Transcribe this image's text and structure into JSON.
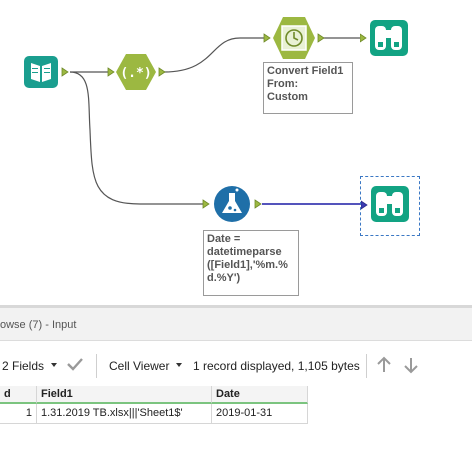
{
  "canvas": {
    "annotations": {
      "convert": "Convert Field1\nFrom:\nCustom",
      "formula": "Date =\ndatetimeparse\n([Field1],'%m.%\nd.%Y')"
    },
    "tools": {
      "input": {
        "icon": "book-icon",
        "color": "#1a9e8f"
      },
      "regex": {
        "icon": "regex-icon",
        "label": "(.*)",
        "color": "#9cb841"
      },
      "datetime": {
        "icon": "clock-icon",
        "color": "#9cb841"
      },
      "formula": {
        "icon": "flask-icon",
        "color": "#1f6fa8"
      },
      "browse_top": {
        "icon": "binoculars-icon",
        "color": "#12a383"
      },
      "browse_bottom": {
        "icon": "binoculars-icon",
        "color": "#12a383"
      }
    },
    "wire_color": "#555555",
    "selected_wire_color": "#3b3bb3"
  },
  "results": {
    "title": "owse (7) - Input",
    "toolbar": {
      "fields": "2 Fields",
      "viewer": "Cell Viewer",
      "status": "1 record displayed, 1,105 bytes"
    },
    "columns": [
      "d",
      "Field1",
      "Date"
    ],
    "rows": [
      {
        "record": "1",
        "field1": "1.31.2019 TB.xlsx|||'Sheet1$'",
        "date": "2019-01-31"
      }
    ]
  }
}
